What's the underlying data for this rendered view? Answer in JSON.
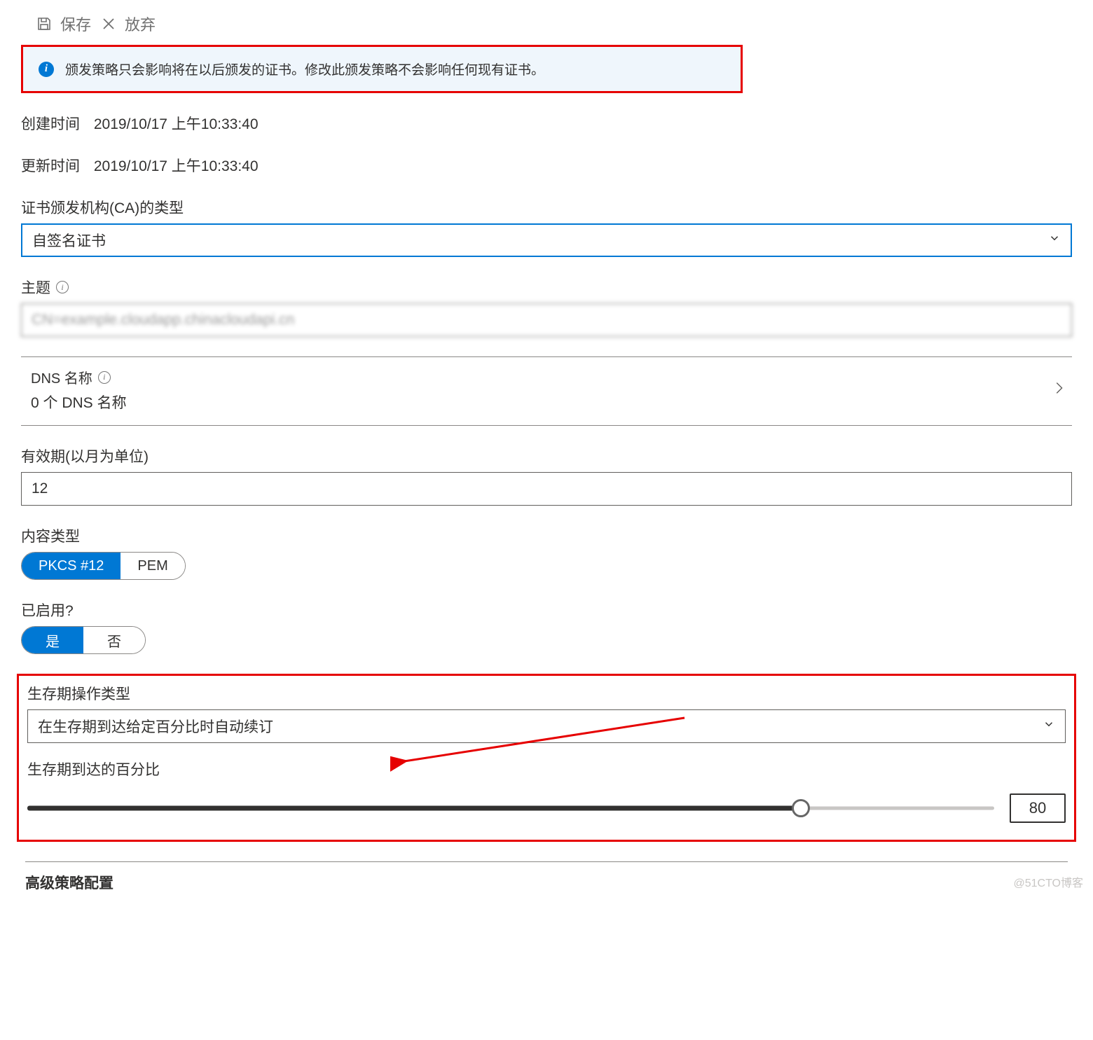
{
  "toolbar": {
    "save_label": "保存",
    "discard_label": "放弃"
  },
  "info_banner": "颁发策略只会影响将在以后颁发的证书。修改此颁发策略不会影响任何现有证书。",
  "meta": {
    "created_label": "创建时间",
    "created_value": "2019/10/17 上午10:33:40",
    "updated_label": "更新时间",
    "updated_value": "2019/10/17 上午10:33:40"
  },
  "ca_type": {
    "label": "证书颁发机构(CA)的类型",
    "value": "自签名证书"
  },
  "subject": {
    "label": "主题",
    "value": "CN=example.cloudapp.chinacloudapi.cn"
  },
  "dns": {
    "label": "DNS 名称",
    "value": "0 个 DNS 名称"
  },
  "validity": {
    "label": "有效期(以月为单位)",
    "value": "12"
  },
  "content_type": {
    "label": "内容类型",
    "options": {
      "pkcs12": "PKCS #12",
      "pem": "PEM"
    },
    "selected": "pkcs12"
  },
  "enabled": {
    "label": "已启用?",
    "options": {
      "yes": "是",
      "no": "否"
    },
    "selected": "yes"
  },
  "lifetime": {
    "action_label": "生存期操作类型",
    "action_value": "在生存期到达给定百分比时自动续订",
    "percent_label": "生存期到达的百分比",
    "percent_value": "80"
  },
  "advanced_label": "高级策略配置",
  "watermark": "@51CTO博客"
}
